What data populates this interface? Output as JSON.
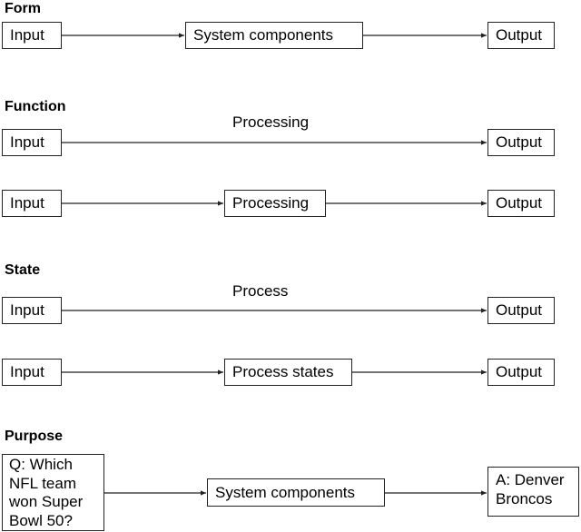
{
  "sections": {
    "form": {
      "heading": "Form",
      "input": "Input",
      "middle": "System components",
      "output": "Output"
    },
    "function": {
      "heading": "Function",
      "row1": {
        "input": "Input",
        "arrow_label": "Processing",
        "output": "Output"
      },
      "row2": {
        "input": "Input",
        "middle": "Processing",
        "output": "Output"
      }
    },
    "state": {
      "heading": "State",
      "row1": {
        "input": "Input",
        "arrow_label": "Process",
        "output": "Output"
      },
      "row2": {
        "input": "Input",
        "middle": "Process states",
        "output": "Output"
      }
    },
    "purpose": {
      "heading": "Purpose",
      "question": "Q: Which NFL team won Super Bowl 50?",
      "middle": "System components",
      "answer": "A: Denver Broncos"
    }
  }
}
